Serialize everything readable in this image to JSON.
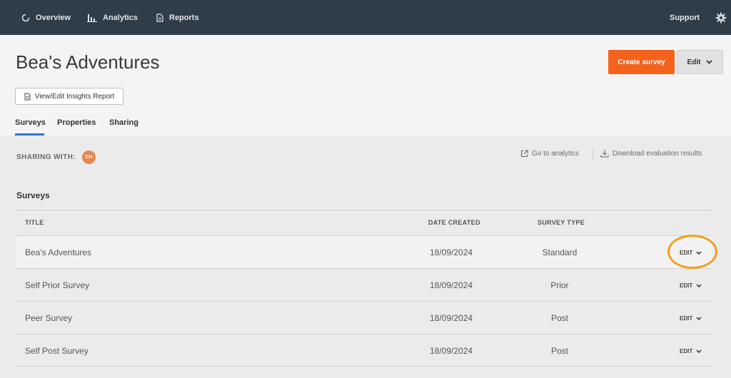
{
  "nav": {
    "overview": "Overview",
    "analytics": "Analytics",
    "reports": "Reports",
    "support": "Support"
  },
  "header": {
    "title": "Bea's Adventures",
    "create_button": "Create survey",
    "edit_button": "Edit",
    "insights_button": "View/Edit Insights Report"
  },
  "tabs": [
    {
      "label": "Surveys",
      "active": true
    },
    {
      "label": "Properties",
      "active": false
    },
    {
      "label": "Sharing",
      "active": false
    }
  ],
  "sharing": {
    "label": "SHARING WITH:",
    "avatar_initials": "CH",
    "avatar_color": "#e4874f"
  },
  "links": {
    "analytics": "Go to analytics",
    "download": "Download evaluation results"
  },
  "surveys": {
    "section_title": "Surveys",
    "columns": [
      "TITLE",
      "DATE CREATED",
      "SURVEY TYPE"
    ],
    "rows": [
      {
        "title": "Bea's Adventures",
        "date": "18/09/2024",
        "type": "Standard",
        "edit": "EDIT"
      },
      {
        "title": "Self Prior Survey",
        "date": "18/09/2024",
        "type": "Prior",
        "edit": "EDIT"
      },
      {
        "title": "Peer Survey",
        "date": "18/09/2024",
        "type": "Post",
        "edit": "EDIT"
      },
      {
        "title": "Self Post Survey",
        "date": "18/09/2024",
        "type": "Post",
        "edit": "EDIT"
      }
    ]
  },
  "colors": {
    "topbar": "#2f3d48",
    "accent": "#f5621c",
    "tab_underline": "#2a7bd4",
    "highlight_ring": "#f29f1f"
  }
}
